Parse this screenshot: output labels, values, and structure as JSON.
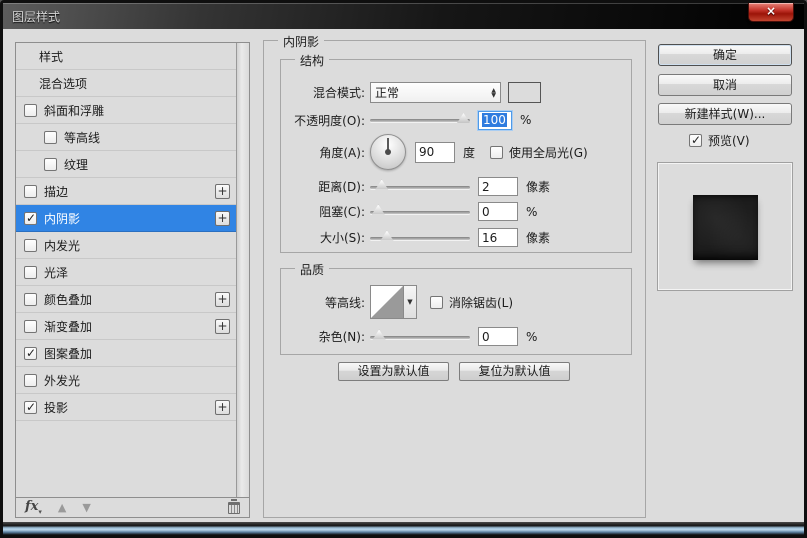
{
  "window": {
    "title": "图层样式"
  },
  "icons": {
    "close": "×",
    "spin_up": "▲",
    "spin_down": "▼",
    "dropdown_arrow": "▼",
    "plus": "+",
    "check": "✓",
    "move_up": "▲",
    "move_down": "▼",
    "fx": "fx",
    "fx_caret": "▾"
  },
  "colors": {
    "selection_blue": "#3084e4",
    "dialog_bg": "#dcdcdc",
    "blend_swatch": "#000000"
  },
  "sidebar": {
    "items": [
      {
        "label": "样式",
        "has_checkbox": false,
        "checked": false,
        "indent": 0,
        "selected": false,
        "plus": false
      },
      {
        "label": "混合选项",
        "has_checkbox": false,
        "checked": false,
        "indent": 0,
        "selected": false,
        "plus": false
      },
      {
        "label": "斜面和浮雕",
        "has_checkbox": true,
        "checked": false,
        "indent": 0,
        "selected": false,
        "plus": false
      },
      {
        "label": "等高线",
        "has_checkbox": true,
        "checked": false,
        "indent": 1,
        "selected": false,
        "plus": false
      },
      {
        "label": "纹理",
        "has_checkbox": true,
        "checked": false,
        "indent": 1,
        "selected": false,
        "plus": false
      },
      {
        "label": "描边",
        "has_checkbox": true,
        "checked": false,
        "indent": 0,
        "selected": false,
        "plus": true
      },
      {
        "label": "内阴影",
        "has_checkbox": true,
        "checked": true,
        "indent": 0,
        "selected": true,
        "plus": true
      },
      {
        "label": "内发光",
        "has_checkbox": true,
        "checked": false,
        "indent": 0,
        "selected": false,
        "plus": false
      },
      {
        "label": "光泽",
        "has_checkbox": true,
        "checked": false,
        "indent": 0,
        "selected": false,
        "plus": false
      },
      {
        "label": "颜色叠加",
        "has_checkbox": true,
        "checked": false,
        "indent": 0,
        "selected": false,
        "plus": true
      },
      {
        "label": "渐变叠加",
        "has_checkbox": true,
        "checked": false,
        "indent": 0,
        "selected": false,
        "plus": true
      },
      {
        "label": "图案叠加",
        "has_checkbox": true,
        "checked": true,
        "indent": 0,
        "selected": false,
        "plus": false
      },
      {
        "label": "外发光",
        "has_checkbox": true,
        "checked": false,
        "indent": 0,
        "selected": false,
        "plus": false
      },
      {
        "label": "投影",
        "has_checkbox": true,
        "checked": true,
        "indent": 0,
        "selected": false,
        "plus": true
      }
    ],
    "footer": {
      "fx_label": "fx"
    }
  },
  "main": {
    "title": "内阴影",
    "structure": {
      "title": "结构",
      "blend_mode": {
        "label": "混合模式:",
        "value": "正常",
        "swatch_color": "#000000"
      },
      "opacity": {
        "label": "不透明度(O):",
        "value": "100",
        "unit": "%",
        "percent": 100,
        "focused": true
      },
      "angle": {
        "label": "角度(A):",
        "value": "90",
        "unit": "度",
        "degrees": 90,
        "global_light_label": "使用全局光(G)",
        "global_light_checked": false
      },
      "distance": {
        "label": "距离(D):",
        "value": "2",
        "unit": "像素",
        "percent": 6
      },
      "choke": {
        "label": "阻塞(C):",
        "value": "0",
        "unit": "%",
        "percent": 2
      },
      "size": {
        "label": "大小(S):",
        "value": "16",
        "unit": "像素",
        "percent": 12
      }
    },
    "quality": {
      "title": "品质",
      "contour": {
        "label": "等高线:",
        "antialias_label": "消除锯齿(L)",
        "antialias_checked": false
      },
      "noise": {
        "label": "杂色(N):",
        "value": "0",
        "unit": "%",
        "percent": 3
      }
    },
    "default_buttons": {
      "set_default": "设置为默认值",
      "reset_default": "复位为默认值"
    }
  },
  "actions": {
    "ok": "确定",
    "cancel": "取消",
    "new_style": "新建样式(W)...",
    "preview_label": "预览(V)",
    "preview_checked": true
  }
}
